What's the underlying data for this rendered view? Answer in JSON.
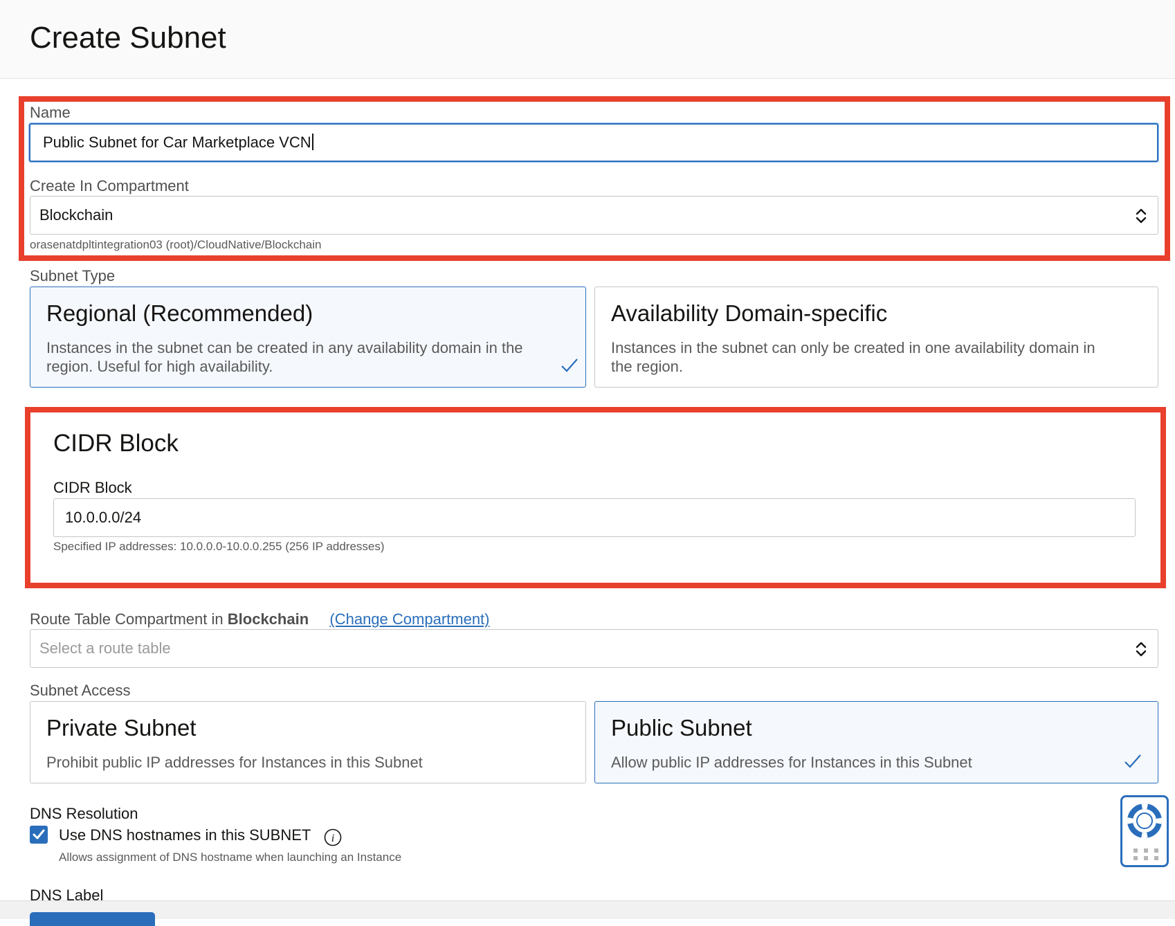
{
  "header": {
    "title": "Create Subnet"
  },
  "name_field": {
    "label": "Name",
    "value": "Public Subnet for Car Marketplace VCN"
  },
  "compartment_field": {
    "label": "Create In Compartment",
    "value": "Blockchain",
    "path": "orasenatdpltintegration03 (root)/CloudNative/Blockchain"
  },
  "subnet_type": {
    "label": "Subnet Type",
    "options": [
      {
        "title": "Regional (Recommended)",
        "desc_line1": "Instances in the subnet can be created in any availability domain in the",
        "desc_line2": "region. Useful for high availability.",
        "selected": true
      },
      {
        "title": "Availability Domain-specific",
        "desc_line1": "Instances in the subnet can only be created in one availability domain in",
        "desc_line2": "the region.",
        "selected": false
      }
    ]
  },
  "cidr_section": {
    "title": "CIDR Block",
    "field_label": "CIDR Block",
    "value": "10.0.0.0/24",
    "helper": "Specified IP addresses: 10.0.0.0-10.0.0.255 (256 IP addresses)"
  },
  "route_table": {
    "label_prefix": "Route Table Compartment in",
    "compartment": "Blockchain",
    "change_link": "(Change Compartment)",
    "placeholder": "Select a route table"
  },
  "subnet_access": {
    "label": "Subnet Access",
    "options": [
      {
        "title": "Private Subnet",
        "desc": "Prohibit public IP addresses for Instances in this Subnet",
        "selected": false
      },
      {
        "title": "Public Subnet",
        "desc": "Allow public IP addresses for Instances in this Subnet",
        "selected": true
      }
    ]
  },
  "dns": {
    "label": "DNS Resolution",
    "checkbox_label": "Use DNS hostnames in this SUBNET",
    "checked": true,
    "helper": "Allows assignment of DNS hostname when launching an Instance"
  },
  "dns_label": {
    "label": "DNS Label"
  },
  "colors": {
    "accent": "#2a6ebb",
    "highlight": "#e8402d"
  },
  "icons": {
    "select": "chevron-up-down-icon",
    "check": "check-icon",
    "info": "info-icon",
    "help": "lifebuoy-icon",
    "grid": "grid-dots-icon"
  }
}
